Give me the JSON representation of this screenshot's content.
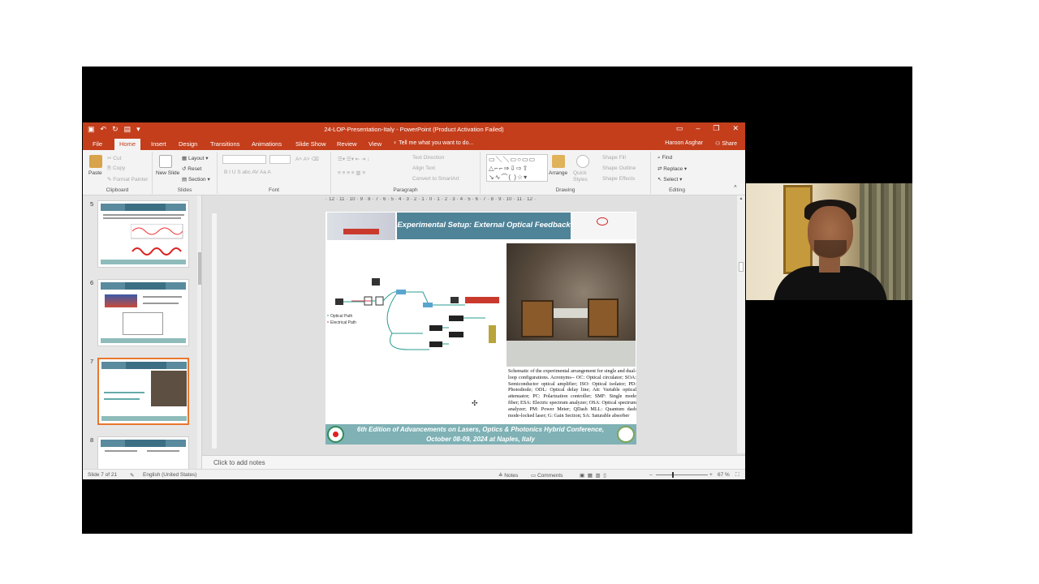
{
  "colors": {
    "accent": "#c43e1c",
    "ribbon_bg": "#f3f3f3",
    "slide_banner": "#4f8398",
    "slide_footer": "#7fb1b5"
  },
  "app": {
    "title": "24-LOP-Presentation-Italy  -  PowerPoint (Product Activation Failed)",
    "tabs": [
      "File",
      "Home",
      "Insert",
      "Design",
      "Transitions",
      "Animations",
      "Slide Show",
      "Review",
      "View"
    ],
    "active_tab": "Home",
    "tell_me": "Tell me what you want to do...",
    "user": "Haroon Asghar",
    "share": "Share"
  },
  "ribbon": {
    "clipboard": {
      "label": "Clipboard",
      "paste": "Paste",
      "cut": "Cut",
      "copy": "Copy",
      "format_painter": "Format Painter"
    },
    "slides": {
      "label": "Slides",
      "new_slide": "New Slide",
      "layout": "Layout",
      "reset": "Reset",
      "section": "Section"
    },
    "font": {
      "label": "Font",
      "buttons": "B  I  U  S  abc  AV  Aa  A"
    },
    "paragraph": {
      "label": "Paragraph",
      "text_direction": "Text Direction",
      "align_text": "Align Text",
      "convert": "Convert to SmartArt"
    },
    "drawing": {
      "label": "Drawing",
      "arrange": "Arrange",
      "quick_styles": "Quick Styles",
      "shape_fill": "Shape Fill",
      "shape_outline": "Shape Outline",
      "shape_effects": "Shape Effects"
    },
    "editing": {
      "label": "Editing",
      "find": "Find",
      "replace": "Replace",
      "select": "Select"
    }
  },
  "thumbnails": [
    {
      "num": "5"
    },
    {
      "num": "6"
    },
    {
      "num": "7",
      "selected": true
    },
    {
      "num": "8"
    }
  ],
  "ruler": "· 12 · 11 · 10 · 9 · 8 · 7 · 6 · 5 · 4 · 3 · 2 · 1 · 0 · 1 · 2 · 3 · 4 · 5 · 6 · 7 · 8 · 9 · 10 · 11 · 12 ·",
  "slide": {
    "title": "Experimental Setup: External Optical Feedback",
    "legend_optical": "Optical Path",
    "legend_electrical": "Electrical Path",
    "caption": "Schematic of the experimental arrangement for single and dual-loop configurations. Acronyms-- OC: Optical circulator; SOA: Semiconductor optical amplifier; ISO: Optical isolator; PD: Photodiode; ODL: Optical delay line; Att: Variable optical attenuator; PC: Polarization controller; SMF: Single mode fiber; ESA: Electric spectrum analyzer; OSA: Optical spectrum analyzer; PM: Power Meter; QDash MLL: Quantum dash mode-locked laser; G: Gain Section; SA: Saturable absorber",
    "footer_line1": "6th Edition of Advancements on Lasers, Optics & Photonics Hybrid Conference,",
    "footer_line2": "October 08-09, 2024 at Naples, Italy"
  },
  "notes_placeholder": "Click to add notes",
  "status": {
    "slide_of": "Slide 7 of 21",
    "language": "English (United States)",
    "notes": "Notes",
    "comments": "Comments",
    "zoom": "67 %"
  }
}
